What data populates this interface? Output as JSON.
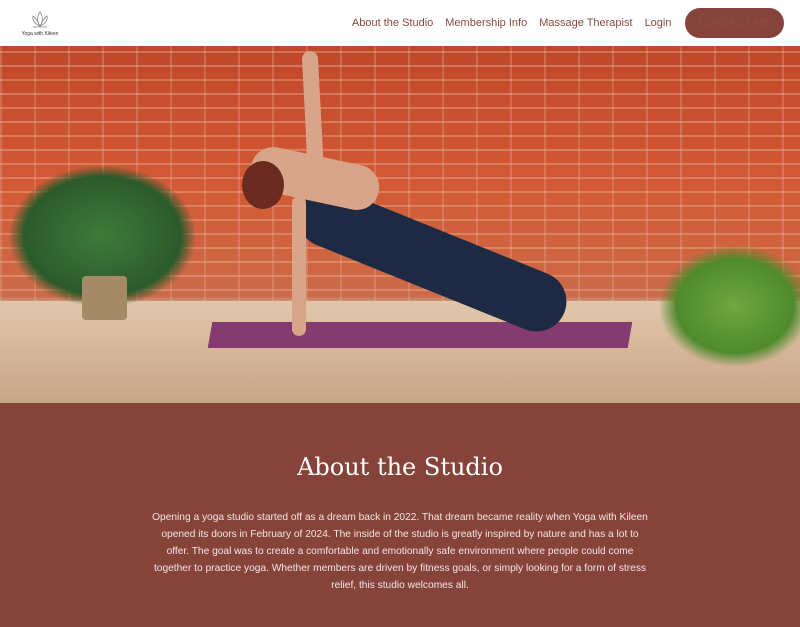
{
  "logo": {
    "text": "Yoga with Kileen"
  },
  "nav": {
    "links": [
      "About the Studio",
      "Membership Info",
      "Massage Therapist",
      "Login"
    ],
    "cta": "CONTACT ME"
  },
  "about": {
    "title": "About the Studio",
    "body": "Opening a yoga studio started off as a dream back in 2022. That dream became reality when Yoga with Kileen opened its doors in February of 2024. The inside of the studio is greatly inspired by nature and has a lot to offer. The goal was to create a comfortable and emotionally safe environment where people could come together to practice yoga. Whether members are driven by fitness goals, or simply looking for a form of stress relief, this studio welcomes all."
  },
  "colors": {
    "brand": "#86433a"
  }
}
